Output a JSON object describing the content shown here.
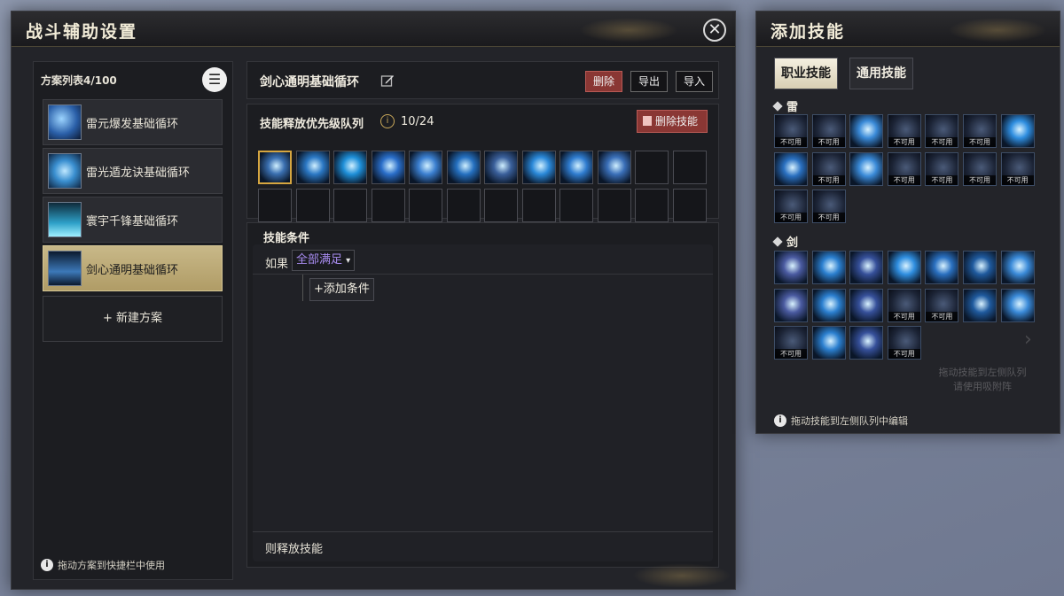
{
  "main_panel": {
    "title": "战斗辅助设置",
    "close_glyph": "✕"
  },
  "scheme_list": {
    "header": "方案列表4/100",
    "menu_glyph": "☰",
    "items": [
      {
        "label": "雷元爆发基础循环",
        "icon": "thunder-burst-icon",
        "active": false
      },
      {
        "label": "雷光遁龙诀基础循环",
        "icon": "thunder-dragon-icon",
        "active": false
      },
      {
        "label": "寰宇千锋基础循环",
        "icon": "thousand-blades-icon",
        "active": false
      },
      {
        "label": "剑心通明基础循环",
        "icon": "sword-heart-icon",
        "active": true
      }
    ],
    "new_scheme": "+ 新建方案",
    "hint": "拖动方案到快捷栏中使用"
  },
  "scheme_header": {
    "name": "剑心通明基础循环",
    "delete_label": "删除",
    "export_label": "导出",
    "import_label": "导入"
  },
  "queue": {
    "title": "技能释放优先级队列",
    "info_glyph": "i",
    "count": "10/24",
    "delete_skill_label": "删除技能",
    "filled_slots": 10,
    "total_slots": 24,
    "slot_hues": [
      "#3a6fb0",
      "#2b78c4",
      "#1e8fd8",
      "#2a6ec9",
      "#3b7fd0",
      "#2570c0",
      "#3a5f9a",
      "#2a88d8",
      "#2f7ccf",
      "#3a6fb8"
    ]
  },
  "conditions": {
    "title": "技能条件",
    "if_label": "如果",
    "if_value": "全部满足",
    "add_condition": "+添加条件",
    "then_label": "则释放技能"
  },
  "side_panel": {
    "title": "添加技能",
    "tabs": [
      {
        "label": "职业技能",
        "active": true
      },
      {
        "label": "通用技能",
        "active": false
      }
    ],
    "categories": [
      {
        "label": "雷",
        "skills": [
          {
            "available": false
          },
          {
            "available": false
          },
          {
            "available": true
          },
          {
            "available": false
          },
          {
            "available": false
          },
          {
            "available": false
          },
          {
            "available": true
          },
          {
            "available": true
          },
          {
            "available": false
          },
          {
            "available": true
          },
          {
            "available": false
          },
          {
            "available": false
          },
          {
            "available": false
          },
          {
            "available": false
          },
          {
            "available": false
          },
          {
            "available": false
          }
        ]
      },
      {
        "label": "剑",
        "skills": [
          {
            "available": true
          },
          {
            "available": true
          },
          {
            "available": true
          },
          {
            "available": true
          },
          {
            "available": true
          },
          {
            "available": true
          },
          {
            "available": true
          },
          {
            "available": true
          },
          {
            "available": true
          },
          {
            "available": true
          },
          {
            "available": false
          },
          {
            "available": false
          },
          {
            "available": true
          },
          {
            "available": true
          },
          {
            "available": false
          },
          {
            "available": true
          },
          {
            "available": true
          },
          {
            "available": false
          }
        ]
      }
    ],
    "unavailable_label": "不可用",
    "faded_text_1": "拖动技能到左侧队列",
    "faded_text_2": "请使用吸附阵",
    "hint": "拖动技能到左侧队列中编辑"
  }
}
